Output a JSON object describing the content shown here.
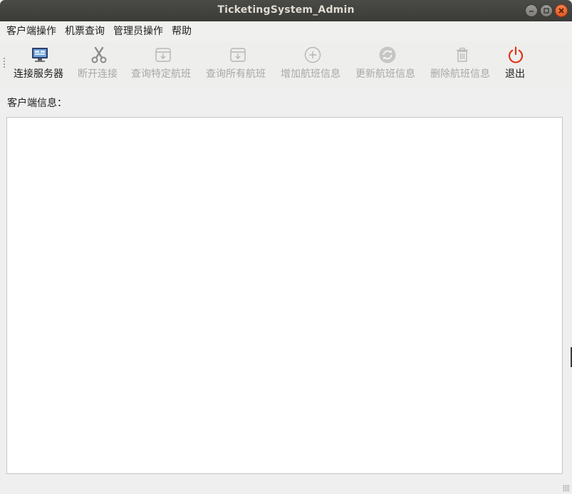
{
  "window": {
    "title": "TicketingSystem_Admin"
  },
  "menubar": {
    "items": [
      "客户端操作",
      "机票查询",
      "管理员操作",
      "帮助"
    ]
  },
  "toolbar": {
    "buttons": [
      {
        "label": "连接服务器",
        "icon": "server-monitor-icon",
        "enabled": true
      },
      {
        "label": "断开连接",
        "icon": "scissors-icon",
        "enabled": false
      },
      {
        "label": "查询特定航班",
        "icon": "archive-download-icon",
        "enabled": false
      },
      {
        "label": "查询所有航班",
        "icon": "archive-download-icon",
        "enabled": false
      },
      {
        "label": "增加航班信息",
        "icon": "add-circle-icon",
        "enabled": false
      },
      {
        "label": "更新航班信息",
        "icon": "refresh-icon",
        "enabled": false
      },
      {
        "label": "删除航班信息",
        "icon": "trash-icon",
        "enabled": false
      },
      {
        "label": "退出",
        "icon": "power-icon",
        "enabled": true
      }
    ]
  },
  "client_info": {
    "label": "客户端信息：",
    "content": ""
  },
  "colors": {
    "titlebar": "#3b3b38",
    "close_button": "#e95420",
    "disabled_text": "#a8a8a5",
    "power_icon": "#e0341a"
  }
}
